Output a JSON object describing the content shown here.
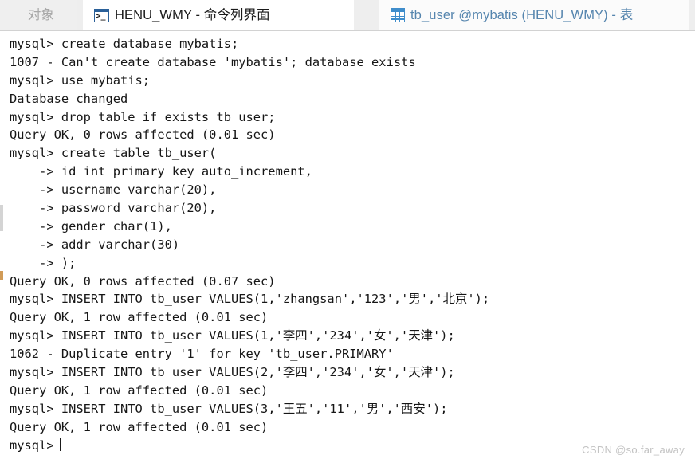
{
  "window": {
    "title": "HENU_WMY - 命令列界面",
    "background_color": "#ffffff",
    "tabbar_color": "#eeeeee"
  },
  "tabs": [
    {
      "id": "objects",
      "label": "对象",
      "icon": "none",
      "active": false,
      "disabled": true,
      "color": "#a8a8a8"
    },
    {
      "id": "command-line",
      "label": "HENU_WMY - 命令列界面",
      "icon": "terminal-icon",
      "icon_glyph": ">_",
      "active": true,
      "disabled": false,
      "color": "#1a1a1a",
      "icon_color": "#2a6099"
    },
    {
      "id": "table-tb-user",
      "label": "tb_user @mybatis (HENU_WMY) - 表",
      "icon": "table-grid-icon",
      "active": false,
      "disabled": false,
      "color": "#5585ae",
      "icon_color": "#3f8dcb"
    }
  ],
  "console": {
    "font": "monospace",
    "text_color": "#161616",
    "background_color": "#ffffff",
    "prompt": "mysql>",
    "continuation_prompt": "->",
    "cursor_visible": true,
    "lines": [
      "mysql> create database mybatis;",
      "1007 - Can't create database 'mybatis'; database exists",
      "mysql> use mybatis;",
      "Database changed",
      "mysql> drop table if exists tb_user;",
      "Query OK, 0 rows affected (0.01 sec)",
      "mysql> create table tb_user(",
      "    -> id int primary key auto_increment,",
      "    -> username varchar(20),",
      "    -> password varchar(20),",
      "    -> gender char(1),",
      "    -> addr varchar(30)",
      "    -> );",
      "Query OK, 0 rows affected (0.07 sec)",
      "mysql> INSERT INTO tb_user VALUES(1,'zhangsan','123','男','北京');",
      "Query OK, 1 row affected (0.01 sec)",
      "mysql> INSERT INTO tb_user VALUES(1,'李四','234','女','天津');",
      "1062 - Duplicate entry '1' for key 'tb_user.PRIMARY'",
      "mysql> INSERT INTO tb_user VALUES(2,'李四','234','女','天津');",
      "Query OK, 1 row affected (0.01 sec)",
      "mysql> INSERT INTO tb_user VALUES(3,'王五','11','男','西安');",
      "Query OK, 1 row affected (0.01 sec)"
    ],
    "final_prompt": "mysql>"
  },
  "watermark": {
    "text": "CSDN @so.far_away",
    "color": "#c3c3c3"
  }
}
